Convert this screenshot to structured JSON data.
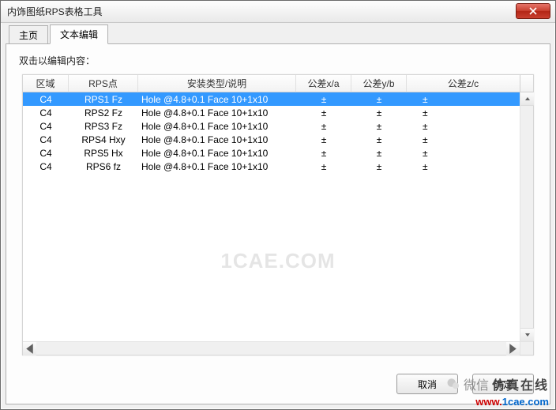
{
  "window": {
    "title": "内饰图纸RPS表格工具"
  },
  "tabs": {
    "main": "主页",
    "textedit": "文本编辑"
  },
  "instruction": "双击以编辑内容：",
  "columns": {
    "region": "区域",
    "rps": "RPS点",
    "type": "安装类型/说明",
    "xa": "公差x/a",
    "yb": "公差y/b",
    "zc": "公差z/c"
  },
  "rows": [
    {
      "region": "C4",
      "rps": "RPS1 Fz",
      "type": "Hole @4.8+0.1 Face 10+1x10",
      "xa": "±",
      "yb": "±",
      "zc": "±",
      "selected": true
    },
    {
      "region": "C4",
      "rps": "RPS2 Fz",
      "type": "Hole @4.8+0.1 Face 10+1x10",
      "xa": "±",
      "yb": "±",
      "zc": "±",
      "selected": false
    },
    {
      "region": "C4",
      "rps": "RPS3 Fz",
      "type": "Hole @4.8+0.1 Face 10+1x10",
      "xa": "±",
      "yb": "±",
      "zc": "±",
      "selected": false
    },
    {
      "region": "C4",
      "rps": "RPS4 Hxy",
      "type": "Hole @4.8+0.1 Face 10+1x10",
      "xa": "±",
      "yb": "±",
      "zc": "±",
      "selected": false
    },
    {
      "region": "C4",
      "rps": "RPS5 Hx",
      "type": "Hole @4.8+0.1 Face 10+1x10",
      "xa": "±",
      "yb": "±",
      "zc": "±",
      "selected": false
    },
    {
      "region": "C4",
      "rps": "RPS6 fz",
      "type": "Hole @4.8+0.1 Face 10+1x10",
      "xa": "±",
      "yb": "±",
      "zc": "±",
      "selected": false
    }
  ],
  "buttons": {
    "cancel": "取消",
    "ok": "确定"
  },
  "watermark": "1CAE.COM",
  "footer": {
    "wechat": "微信",
    "brand": "仿真在线",
    "url_prefix": "www.",
    "url_domain": "1cae.com"
  }
}
